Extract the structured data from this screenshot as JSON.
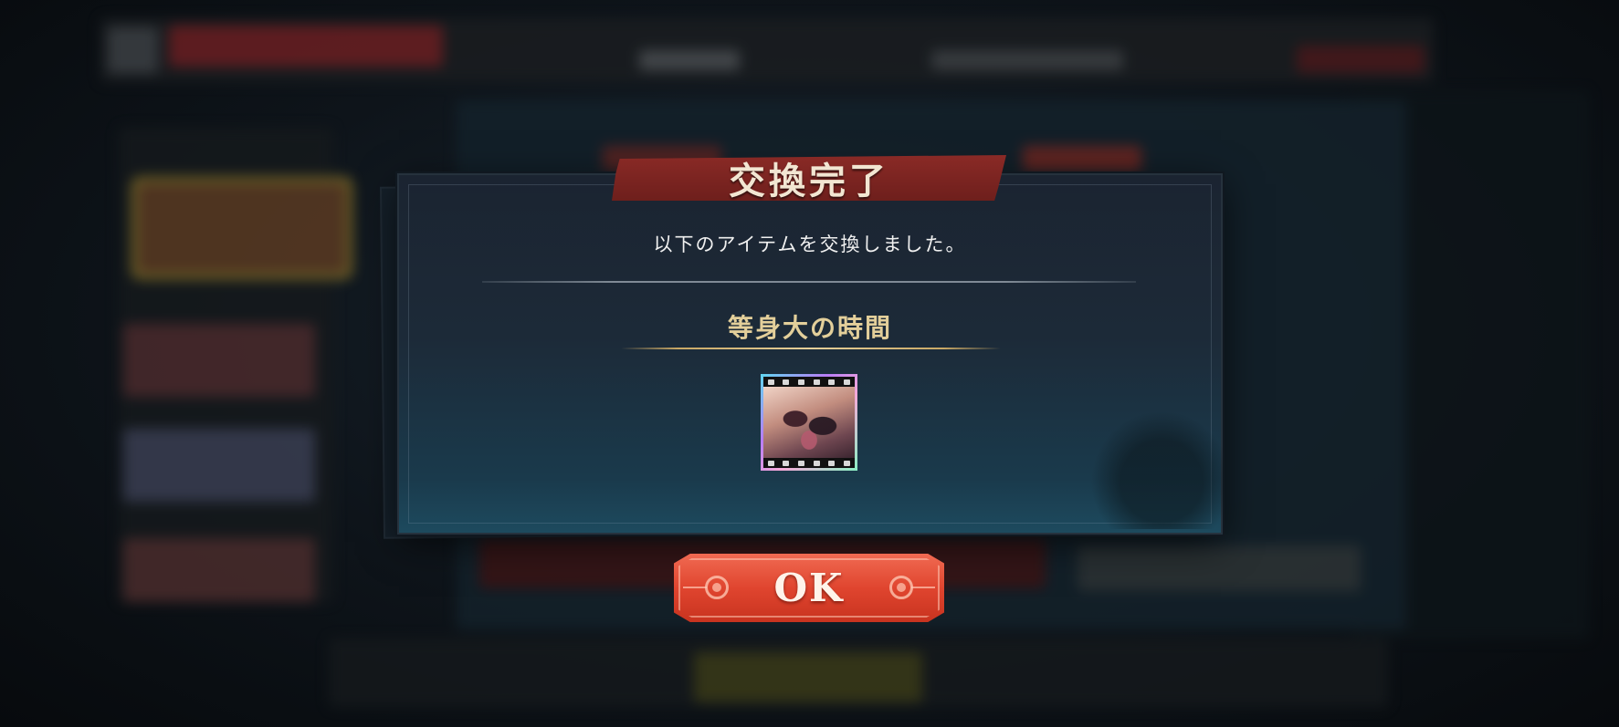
{
  "dialog": {
    "title": "交換完了",
    "message": "以下のアイテムを交換しました。",
    "item": {
      "name": "等身大の時間",
      "icon": "film-photo-icon"
    },
    "ok_label": "OK"
  },
  "colors": {
    "banner": "#7a2420",
    "ok_button": "#e0452f",
    "item_name": "#e3cf9a",
    "dialog_bg": "#1c2a38"
  }
}
